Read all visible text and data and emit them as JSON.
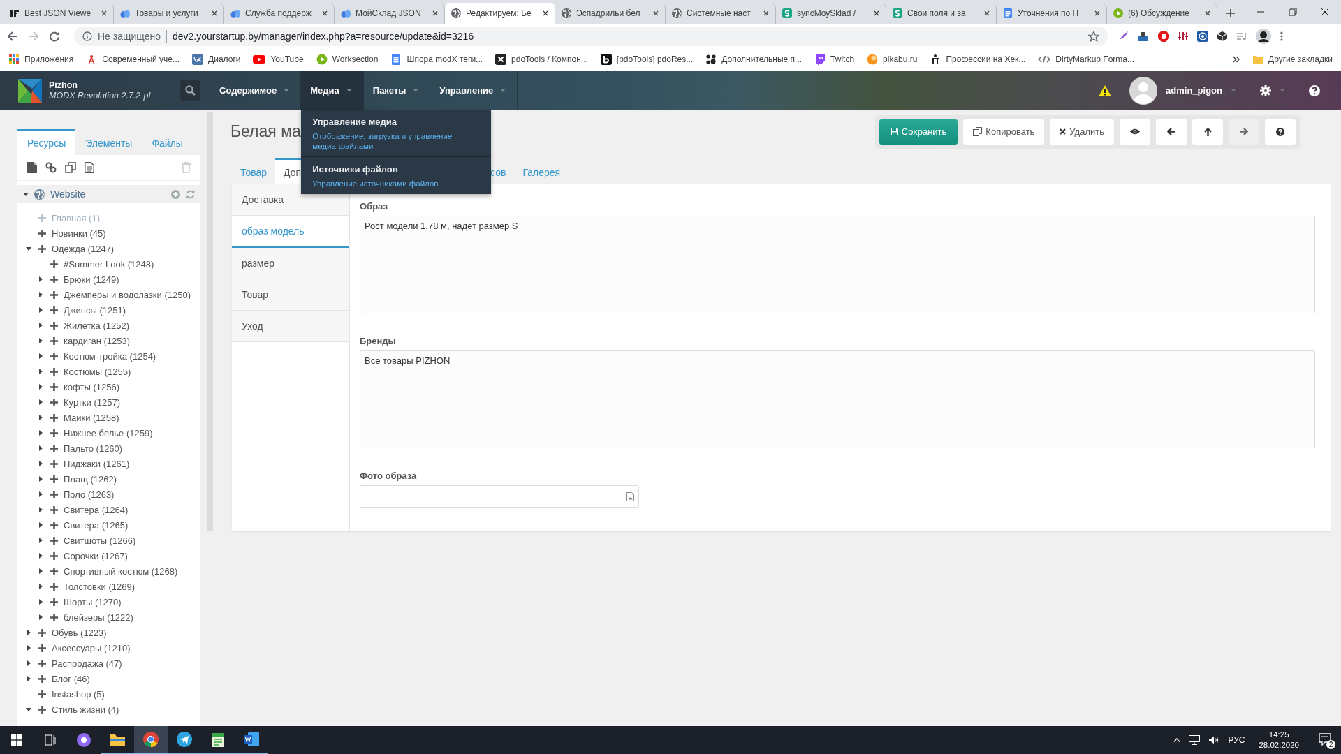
{
  "browser": {
    "tabs": [
      {
        "title": "Best JSON Viewe",
        "selected": false
      },
      {
        "title": "Товары и услуги",
        "selected": false
      },
      {
        "title": "Служба поддерж",
        "selected": false
      },
      {
        "title": "МойСклад JSON",
        "selected": false
      },
      {
        "title": "Редактируем: Бе",
        "selected": true
      },
      {
        "title": "Эспадрильи бел",
        "selected": false
      },
      {
        "title": "Системные наст",
        "selected": false
      },
      {
        "title": "syncMoySklad / ",
        "selected": false
      },
      {
        "title": "Свои поля и за",
        "selected": false
      },
      {
        "title": "Уточнения по П",
        "selected": false
      },
      {
        "title": "(6) Обсуждение",
        "selected": false
      }
    ],
    "security": "Не защищено",
    "url": "dev2.yourstartup.by/manager/index.php?a=resource/update&id=3216",
    "bookmarks": [
      "Приложения",
      "Современный уче...",
      "Диалоги",
      "YouTube",
      "Worksection",
      "Шпора modX теги...",
      "pdoTools / Компон...",
      "[pdoTools] pdoRes...",
      "Дополнительные п...",
      "Twitch",
      "pikabu.ru",
      "Профессии на Хек...",
      "DirtyMarkup Forma..."
    ],
    "other_bookmarks": "Другие закладки"
  },
  "header": {
    "site_name": "Pizhon",
    "version": "MODX Revolution 2.7.2-pl",
    "menu": [
      {
        "label": "Содержимое",
        "expanded": false
      },
      {
        "label": "Медиа",
        "expanded": true
      },
      {
        "label": "Пакеты",
        "expanded": false
      },
      {
        "label": "Управление",
        "expanded": false
      }
    ],
    "dropdown": [
      {
        "title": "Управление медиа",
        "description": "Отображение, загрузка и управление медиа-файлами"
      },
      {
        "title": "Источники файлов",
        "description": "Управление источниками файлов"
      }
    ],
    "user": "admin_pigon"
  },
  "sidebar": {
    "tabs": [
      {
        "label": "Ресурсы",
        "selected": true
      },
      {
        "label": "Элементы",
        "selected": false
      },
      {
        "label": "Файлы",
        "selected": false
      }
    ],
    "root": {
      "label": "Website",
      "expanded": true
    },
    "tree": [
      {
        "label": "Главная (1)",
        "kind": "leaf",
        "published": false
      },
      {
        "label": "Новинки (45)",
        "kind": "leaf",
        "published": true
      },
      {
        "label": "Одежда (1247)",
        "kind": "folder",
        "expanded": true,
        "published": true,
        "children": [
          {
            "label": "#Summer Look (1248)",
            "kind": "leaf",
            "published": true
          },
          {
            "label": "Брюки (1249)",
            "kind": "folder",
            "expanded": false,
            "published": true
          },
          {
            "label": "Джемперы и водолазки (1250)",
            "kind": "folder",
            "expanded": false,
            "published": true
          },
          {
            "label": "Джинсы (1251)",
            "kind": "folder",
            "expanded": false,
            "published": true
          },
          {
            "label": "Жилетка (1252)",
            "kind": "folder",
            "expanded": false,
            "published": true
          },
          {
            "label": "кардиган (1253)",
            "kind": "folder",
            "expanded": false,
            "published": true
          },
          {
            "label": "Костюм-тройка (1254)",
            "kind": "folder",
            "expanded": false,
            "published": true
          },
          {
            "label": "Костюмы (1255)",
            "kind": "folder",
            "expanded": false,
            "published": true
          },
          {
            "label": "кофты (1256)",
            "kind": "folder",
            "expanded": false,
            "published": true
          },
          {
            "label": "Куртки (1257)",
            "kind": "folder",
            "expanded": false,
            "published": true
          },
          {
            "label": "Майки (1258)",
            "kind": "folder",
            "expanded": false,
            "published": true
          },
          {
            "label": "Нижнее белье (1259)",
            "kind": "folder",
            "expanded": false,
            "published": true
          },
          {
            "label": "Пальто (1260)",
            "kind": "folder",
            "expanded": false,
            "published": true
          },
          {
            "label": "Пиджаки (1261)",
            "kind": "folder",
            "expanded": false,
            "published": true
          },
          {
            "label": "Плащ (1262)",
            "kind": "folder",
            "expanded": false,
            "published": true
          },
          {
            "label": "Поло (1263)",
            "kind": "folder",
            "expanded": false,
            "published": true
          },
          {
            "label": "Свитера (1264)",
            "kind": "folder",
            "expanded": false,
            "published": true
          },
          {
            "label": "Свитера (1265)",
            "kind": "folder",
            "expanded": false,
            "published": true
          },
          {
            "label": "Свитшоты (1266)",
            "kind": "folder",
            "expanded": false,
            "published": true
          },
          {
            "label": "Сорочки (1267)",
            "kind": "folder",
            "expanded": false,
            "published": true
          },
          {
            "label": "Спортивный костюм (1268)",
            "kind": "folder",
            "expanded": false,
            "published": true
          },
          {
            "label": "Толстовки (1269)",
            "kind": "folder",
            "expanded": false,
            "published": true
          },
          {
            "label": "Шорты (1270)",
            "kind": "folder",
            "expanded": false,
            "published": true
          },
          {
            "label": "блейзеры (1222)",
            "kind": "folder",
            "expanded": false,
            "published": true
          }
        ]
      },
      {
        "label": "Обувь (1223)",
        "kind": "folder",
        "expanded": false,
        "published": true
      },
      {
        "label": "Аксессуары (1210)",
        "kind": "folder",
        "expanded": false,
        "published": true
      },
      {
        "label": "Распродажа (47)",
        "kind": "folder",
        "expanded": false,
        "published": true
      },
      {
        "label": "Блог (46)",
        "kind": "folder",
        "expanded": false,
        "published": true
      },
      {
        "label": "Instashop (5)",
        "kind": "leaf",
        "published": true
      },
      {
        "label": "Стиль жизни (4)",
        "kind": "folder",
        "expanded": true,
        "published": true
      }
    ]
  },
  "main": {
    "title": "Белая ма",
    "actions": [
      {
        "kind": "primary",
        "label": "Сохранить",
        "disabled": false
      },
      {
        "kind": "default",
        "label": "Копировать",
        "disabled": false
      },
      {
        "kind": "default",
        "label": "Удалить",
        "disabled": false
      },
      {
        "kind": "icon",
        "disabled": false
      },
      {
        "kind": "icon",
        "disabled": false
      },
      {
        "kind": "icon",
        "disabled": false
      },
      {
        "kind": "icon",
        "disabled": true
      },
      {
        "kind": "icon",
        "disabled": false
      }
    ],
    "tabs": [
      {
        "label": "Товар",
        "selected": false
      },
      {
        "label": "Доп",
        "selected": true
      },
      {
        "label": "сов",
        "selected": false
      },
      {
        "label": "Галерея",
        "selected": false
      }
    ],
    "side_tabs": [
      {
        "label": "Доставка",
        "selected": false
      },
      {
        "label": "образ модель",
        "selected": true
      },
      {
        "label": "размер",
        "selected": false
      },
      {
        "label": "Товар",
        "selected": false
      },
      {
        "label": "Уход",
        "selected": false
      }
    ],
    "fields": [
      {
        "label": "Образ",
        "kind": "textarea",
        "value": "Рост модели 1,78 м, надет размер S"
      },
      {
        "label": "Бренды",
        "kind": "textarea",
        "value": "Все товары PIZHON"
      },
      {
        "label": "Фото образа",
        "kind": "image"
      }
    ]
  },
  "taskbar": {
    "apps": [
      {
        "running": true,
        "active": false
      },
      {
        "running": true,
        "active": true
      },
      {
        "running": true,
        "active": false
      },
      {
        "running": true,
        "active": false
      },
      {
        "running": true,
        "active": false
      }
    ],
    "language": "РУС",
    "time": "14:25",
    "date": "28.02.2020",
    "notifications": "2"
  }
}
